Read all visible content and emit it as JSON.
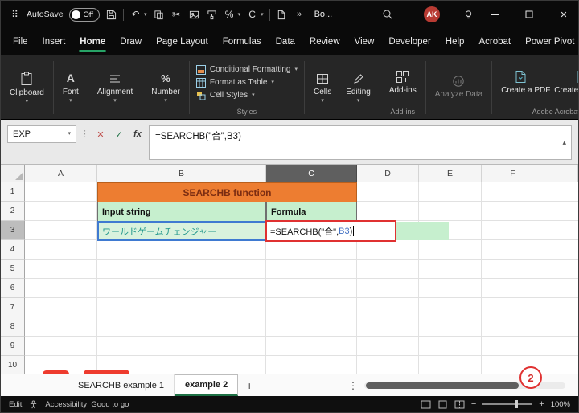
{
  "glyphs": {
    "apps": "⠿",
    "chevron_down": "▾",
    "collapse_up": "▴",
    "overflow": "»",
    "dots": "⋮",
    "plus": "+",
    "minus": "−",
    "close": "✕",
    "cancel": "✕",
    "check": "✓",
    "fx": "fx",
    "undo": "↶",
    "scissors": "✂",
    "percent": "%",
    "clear": "C",
    "font_a": "A"
  },
  "titlebar": {
    "autosave_label": "AutoSave",
    "autosave_state": "Off",
    "workbook_name": "Bo...",
    "avatar_initials": "AK"
  },
  "ribbon_tabs": [
    "File",
    "Insert",
    "Home",
    "Draw",
    "Page Layout",
    "Formulas",
    "Data",
    "Review",
    "View",
    "Developer",
    "Help",
    "Acrobat",
    "Power Pivot"
  ],
  "ribbon": {
    "clipboard": "Clipboard",
    "font": "Font",
    "alignment": "Alignment",
    "number": "Number",
    "conditional_formatting": "Conditional Formatting",
    "format_as_table": "Format as Table",
    "cell_styles": "Cell Styles",
    "styles_group": "Styles",
    "cells": "Cells",
    "editing": "Editing",
    "addins_button": "Add-ins",
    "addins_group": "Add-ins",
    "analyze_data": "Analyze Data",
    "create_pdf": "Create a PDF",
    "create_pdf_share": "Create a PDF and Share link",
    "acrobat_group": "Adobe Acrobat"
  },
  "formula_bar": {
    "name_box": "EXP",
    "formula": "=SEARCHB(\"合\",B3)"
  },
  "grid": {
    "columns": [
      "A",
      "B",
      "C",
      "D",
      "E",
      "F"
    ],
    "selected_column": "C",
    "selected_row": "3",
    "rows": [
      "1",
      "2",
      "3",
      "4",
      "5",
      "6",
      "7",
      "8",
      "9",
      "10"
    ],
    "cells": {
      "title": "SEARCHB function",
      "input_header": "Input string",
      "formula_header": "Formula",
      "input_value": "ワールドゲームチェンジャー",
      "formula_pre": "=SEARCHB(\"合\",",
      "formula_ref": "B3",
      "formula_post": ")"
    }
  },
  "sheets": {
    "tab1": "SEARCHB example 1",
    "tab2": "example 2"
  },
  "annotation": {
    "number": "2"
  },
  "status": {
    "mode": "Edit",
    "accessibility": "Accessibility: Good to go",
    "zoom": "100%"
  },
  "colors": {
    "accent_green": "#27a366",
    "header_orange": "#ED7D31",
    "cell_green": "#C6EFCE",
    "ref_blue": "#4472C4",
    "edit_red": "#E03131",
    "avatar_red": "#b83b33"
  }
}
